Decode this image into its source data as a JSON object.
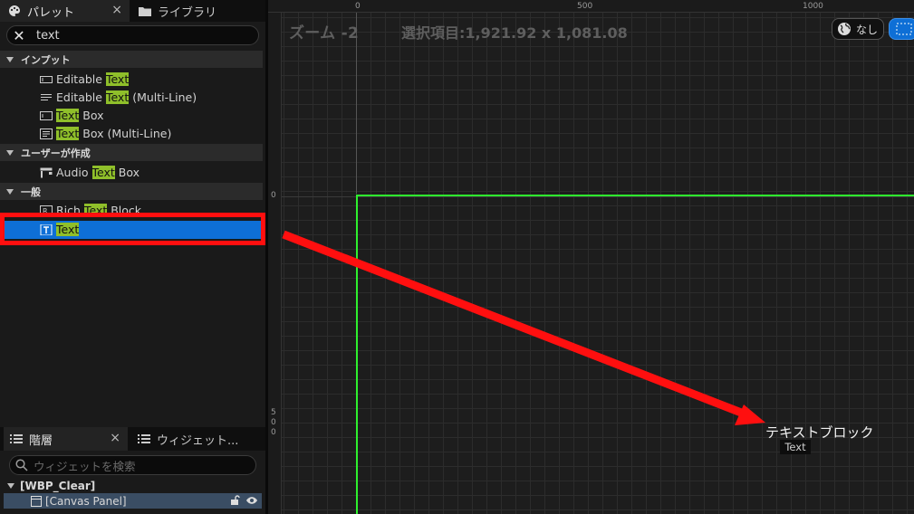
{
  "palette": {
    "tab_palette": "パレット",
    "tab_library": "ライブラリ",
    "close_glyph": "×",
    "search_value": "text",
    "categories": [
      {
        "name": "インプット",
        "items": [
          {
            "pre": "Editable ",
            "match": "Text",
            "post": ""
          },
          {
            "pre": "Editable ",
            "match": "Text",
            "post": " (Multi-Line)"
          },
          {
            "pre": "",
            "match": "Text",
            "post": " Box"
          },
          {
            "pre": "",
            "match": "Text",
            "post": " Box (Multi-Line)"
          }
        ]
      },
      {
        "name": "ユーザーが作成",
        "items": [
          {
            "pre": "Audio ",
            "match": "Text",
            "post": " Box"
          }
        ]
      },
      {
        "name": "一般",
        "items": [
          {
            "pre": "Rich ",
            "match": "Text",
            "post": " Block"
          },
          {
            "pre": "",
            "match": "Text",
            "post": ""
          }
        ]
      }
    ],
    "highlight_color": "#8fbf2a",
    "selection_color": "#0e6fd6"
  },
  "hierarchy": {
    "tab_hierarchy": "階層",
    "tab_widget": "ウィジェット...",
    "close_glyph": "×",
    "search_placeholder": "ウィジェットを検索",
    "root_name": "[WBP_Clear]",
    "child_name": "[Canvas Panel]"
  },
  "designer": {
    "zoom": "ズーム -2",
    "selection_info": "選択項目:1,921.92 x 1,081.08",
    "ruler_top": [
      "0",
      "500",
      "1000"
    ],
    "ruler_left_zero": "0",
    "ruler_left_500": [
      "5",
      "0",
      "0"
    ],
    "locale_label": "なし",
    "drop_label": "テキストブロック",
    "drop_tag": "Text",
    "guide_color": "#2ef02e",
    "annotation_color": "#ff0f0f"
  }
}
